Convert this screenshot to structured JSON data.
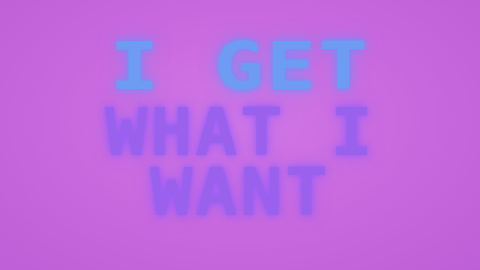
{
  "lines": [
    "I GET",
    "WHAT I",
    "WANT"
  ],
  "colors": {
    "background": "#c86adf",
    "line_1": "#6f9cf3",
    "line_2_3": "#9a62ec"
  }
}
